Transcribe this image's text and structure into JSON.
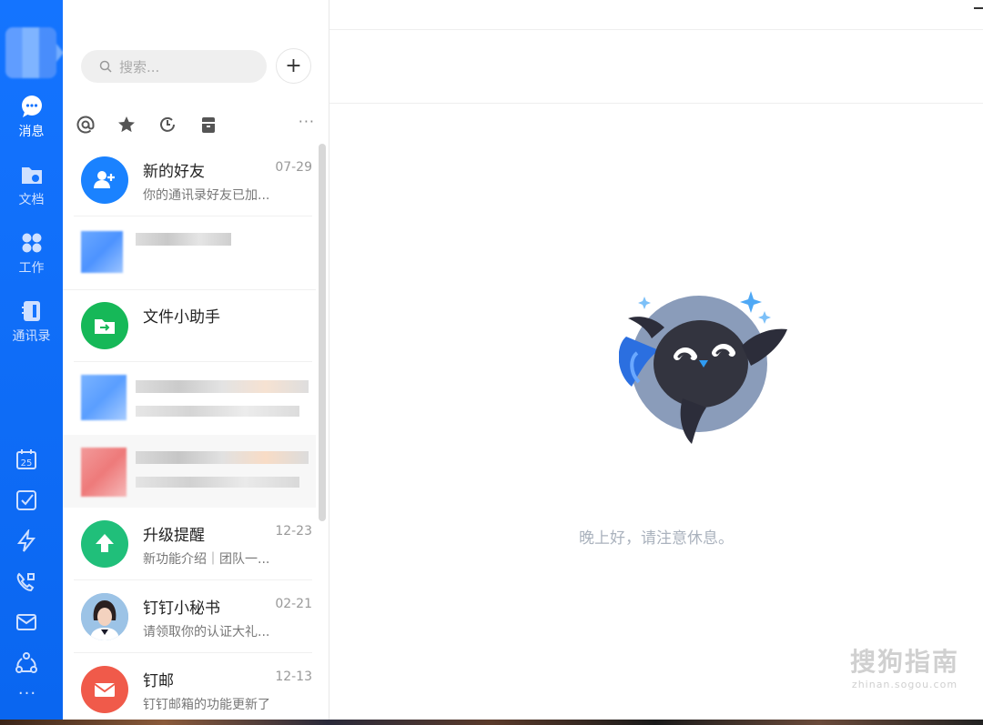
{
  "nav": {
    "items": [
      {
        "label": "消息",
        "icon": "chat-bubble-icon",
        "active": true
      },
      {
        "label": "文档",
        "icon": "folder-icon",
        "active": false
      },
      {
        "label": "工作",
        "icon": "apps-grid-icon",
        "active": false
      },
      {
        "label": "通讯录",
        "icon": "contacts-book-icon",
        "active": false
      }
    ],
    "tools": [
      "calendar-icon",
      "todo-check-icon",
      "lightning-icon",
      "video-call-icon",
      "mail-icon",
      "network-icon",
      "more-dots-icon"
    ],
    "calendar_day": "25",
    "more": "···"
  },
  "search": {
    "placeholder": "搜索..."
  },
  "add_button": "+",
  "filters": [
    "at-mention-icon",
    "star-icon",
    "clock-icon",
    "archive-icon"
  ],
  "filter_more": "···",
  "conversations": [
    {
      "name": "新的好友",
      "time": "07-29",
      "preview": "你的通讯录好友已加...",
      "avatar": "add-friend-icon",
      "color": "#1a82ff"
    },
    {
      "name": "",
      "time": "",
      "preview": "",
      "blurred": true
    },
    {
      "name": "文件小助手",
      "time": "",
      "preview": "",
      "avatar": "file-transfer-icon",
      "color": "#16b858"
    },
    {
      "name": "",
      "time": "",
      "preview": "",
      "blurred": true
    },
    {
      "name": "",
      "time": "",
      "preview": "",
      "blurred": true
    },
    {
      "name": "升级提醒",
      "time": "12-23",
      "preview": "新功能介绍｜团队一...",
      "avatar": "upgrade-arrow-icon",
      "color": "#20bf7a"
    },
    {
      "name": "钉钉小秘书",
      "time": "02-21",
      "preview": "请领取你的认证大礼...",
      "avatar": "secretary-avatar",
      "color": "#8fb8e0"
    },
    {
      "name": "钉邮",
      "time": "12-13",
      "preview": "钉钉邮箱的功能更新了",
      "avatar": "mail-envelope-icon",
      "color": "#f05a4a"
    }
  ],
  "main": {
    "greeting": "晚上好，请注意休息。"
  },
  "watermark": {
    "title": "搜狗指南",
    "url": "zhinan.sogou.com"
  }
}
